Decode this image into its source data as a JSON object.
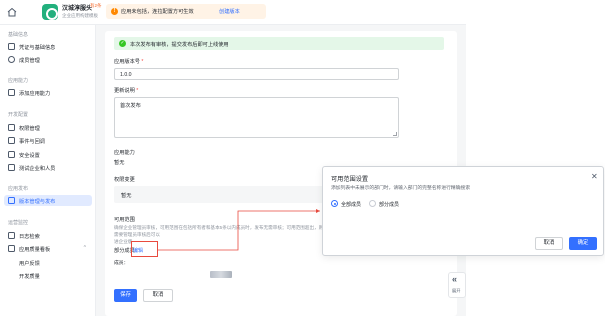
{
  "app": {
    "name": "汉城淳服头",
    "badge": "有2条",
    "subtitle": "企业应用构建模板"
  },
  "notice": {
    "icon": "warning-icon",
    "message": "应用未包括，连拉配置方可生效",
    "link": "创建版本"
  },
  "sidebar": {
    "sections": [
      {
        "title": "基础信息"
      },
      {
        "title": "应用能力"
      },
      {
        "title": "开发配置"
      },
      {
        "title": "应用发布"
      },
      {
        "title": "运营监控"
      }
    ],
    "items": [
      {
        "label": "凭证与基础信息"
      },
      {
        "label": "成员管理"
      },
      {
        "label": "添加应用能力"
      },
      {
        "label": "权限管理"
      },
      {
        "label": "事件与回调"
      },
      {
        "label": "安全设置"
      },
      {
        "label": "测试企业和人员"
      },
      {
        "label": "版本管理与发布"
      },
      {
        "label": "日志检索"
      },
      {
        "label": "应用质量看板"
      },
      {
        "label": "用户反馈"
      },
      {
        "label": "开发质量"
      }
    ]
  },
  "form": {
    "success_message": "本次发布有审核，提交发布后即可上线使用",
    "version_label": "应用版本号",
    "version_value": "1.0.0",
    "notes_label": "更新说明",
    "notes_value": "首次发布",
    "capability_label": "应用能力",
    "capability_value": "暂无",
    "permission_label": "权限变更",
    "permission_value": "暂无",
    "scope_label": "可用范围",
    "scope_desc": "确保企业管理员审核，可用范围在包括所有者和基本5条以内成员时，发布无需审核；可用范围超出，则需要管理员审核后可以",
    "scope_desc_line2": "进企业版",
    "partial_members": "部分成员",
    "edit_link": "编辑",
    "members_label": "成员：",
    "save_label": "保存",
    "cancel_label": "取消"
  },
  "collapse": {
    "label": "展开"
  },
  "modal": {
    "title": "可用范围设置",
    "desc": "添加列表中未展示的部门时，请输入部门的完整名称进行精确搜索",
    "option_all": "全部成员",
    "option_partial": "部分成员",
    "cancel": "取消",
    "confirm": "确定"
  },
  "colors": {
    "primary": "#3370ff",
    "success": "#34c724",
    "warning": "#ff8800",
    "annotation": "#e84a3e"
  }
}
